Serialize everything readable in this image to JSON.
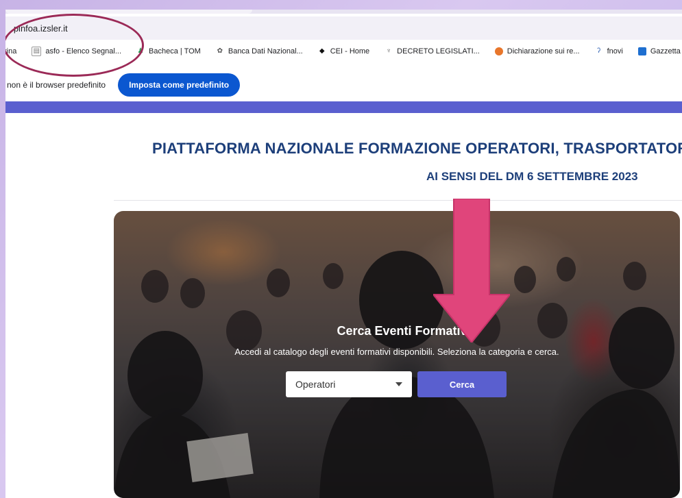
{
  "browser": {
    "address_url": "pinfoa.izsler.it",
    "bookmarks": [
      {
        "label": "rina",
        "icon": "bookmark-icon"
      },
      {
        "label": "asfo - Elenco Segnal...",
        "icon": "document-icon"
      },
      {
        "label": "Bacheca | TOM",
        "icon": "person-icon"
      },
      {
        "label": "Banca Dati Nazional...",
        "icon": "emblem-icon"
      },
      {
        "label": "CEI - Home",
        "icon": "diamond-icon"
      },
      {
        "label": "DECRETO LEGISLATI...",
        "icon": "seal-icon"
      },
      {
        "label": "Dichiarazione sui re...",
        "icon": "circle-icon"
      },
      {
        "label": "fnovi",
        "icon": "mark-icon"
      },
      {
        "label": "Gazzetta uf",
        "icon": "monitor-icon"
      }
    ],
    "infobar": {
      "message": "non è il browser predefinito",
      "button_label": "Imposta come predefinito"
    }
  },
  "site": {
    "title": "PIATTAFORMA NAZIONALE FORMAZIONE OPERATORI, TRASPORTATORI",
    "subtitle": "AI SENSI DEL DM 6 SETTEMBRE 2023",
    "hero": {
      "title": "Cerca Eventi Formativi",
      "description": "Accedi al catalogo degli eventi formativi disponibili. Seleziona la categoria e cerca.",
      "category_selected": "Operatori",
      "search_button": "Cerca"
    }
  },
  "colors": {
    "accent": "#5a5fcf",
    "title_blue": "#1d3f7a",
    "annotation_arrow": "#e0457b",
    "annotation_ellipse": "#9b2a57",
    "default_browser_button": "#0b57d0"
  }
}
